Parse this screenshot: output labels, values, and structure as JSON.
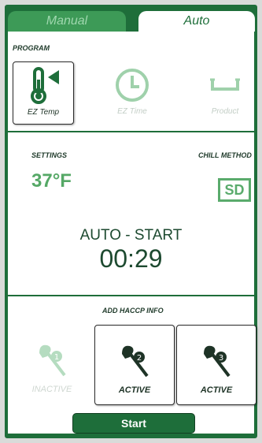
{
  "tabs": {
    "manual": "Manual",
    "auto": "Auto",
    "active_tab": "Auto"
  },
  "program": {
    "heading": "PROGRAM",
    "items": [
      {
        "label": "EZ Temp",
        "icon": "thermometer-icon",
        "selected": true
      },
      {
        "label": "EZ Time",
        "icon": "clock-icon",
        "selected": false
      },
      {
        "label": "Product",
        "icon": "tray-icon",
        "selected": false
      }
    ]
  },
  "settings": {
    "heading": "SETTINGS",
    "value": "37",
    "unit": "°F"
  },
  "chill_method": {
    "heading": "CHILL METHOD",
    "value": "SD"
  },
  "status": {
    "mode": "AUTO - START",
    "timer": "00:29"
  },
  "haccp": {
    "heading": "ADD HACCP INFO",
    "probes": [
      {
        "number": "1",
        "status": "INACTIVE",
        "icon": "probe-icon"
      },
      {
        "number": "2",
        "status": "ACTIVE",
        "icon": "probe-icon"
      },
      {
        "number": "3",
        "status": "ACTIVE",
        "icon": "probe-icon"
      }
    ]
  },
  "actions": {
    "start_label": "Start"
  },
  "colors": {
    "brand_green": "#1e6e3a",
    "light_green": "#5aab6c",
    "inactive": "#c9d9cc"
  }
}
